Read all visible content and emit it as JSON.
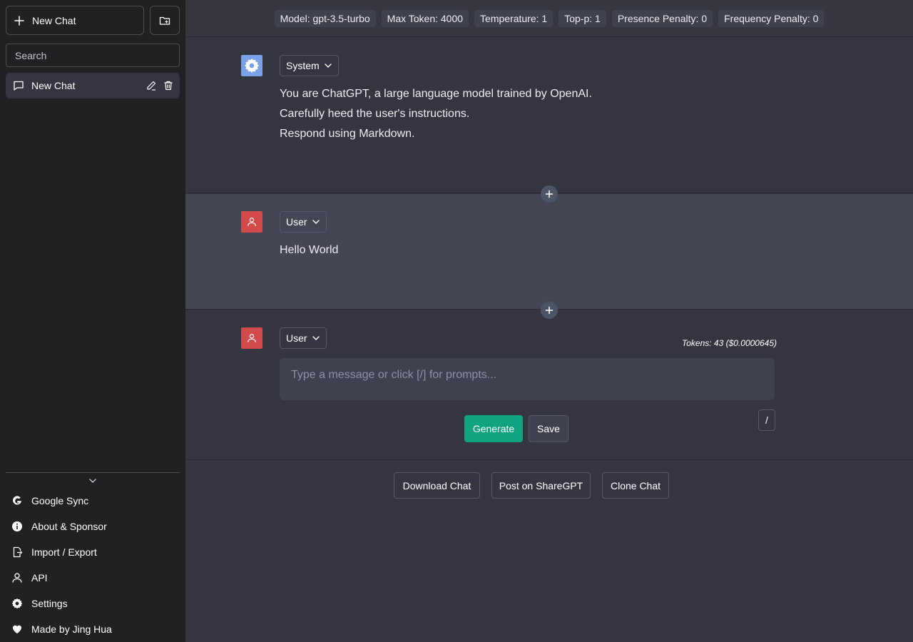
{
  "sidebar": {
    "new_chat_label": "New Chat",
    "new_folder_icon": "folder-plus-icon",
    "search_placeholder": "Search",
    "chats": [
      {
        "label": "New Chat",
        "icon": "chat-bubble-icon"
      }
    ],
    "menu": [
      {
        "label": "Google Sync",
        "icon": "google-icon"
      },
      {
        "label": "About & Sponsor",
        "icon": "info-icon"
      },
      {
        "label": "Import / Export",
        "icon": "file-export-icon"
      },
      {
        "label": "API",
        "icon": "person-icon"
      },
      {
        "label": "Settings",
        "icon": "gear-icon"
      },
      {
        "label": "Made by Jing Hua",
        "icon": "heart-icon"
      }
    ]
  },
  "config": {
    "model": "Model: gpt-3.5-turbo",
    "max_token": "Max Token: 4000",
    "temperature": "Temperature: 1",
    "top_p": "Top-p: 1",
    "presence_penalty": "Presence Penalty: 0",
    "frequency_penalty": "Frequency Penalty: 0"
  },
  "messages": {
    "system": {
      "role": "System",
      "lines": [
        "You are ChatGPT, a large language model trained by OpenAI.",
        "Carefully heed the user's instructions.",
        "Respond using Markdown."
      ]
    },
    "user": {
      "role": "User",
      "text": "Hello World"
    },
    "composer": {
      "role": "User",
      "tokens": "Tokens: 43 ($0.0000645)",
      "placeholder": "Type a message or click [/] for prompts...",
      "generate_label": "Generate",
      "save_label": "Save",
      "prompt_label": "/"
    }
  },
  "footer": {
    "download_label": "Download Chat",
    "share_label": "Post on ShareGPT",
    "clone_label": "Clone Chat"
  },
  "colors": {
    "sidebar_bg": "#202123",
    "main_bg": "#343541",
    "user_msg_bg": "#444654",
    "accent_green": "#10a37f",
    "system_avatar": "#7aa2e8",
    "user_avatar": "#d24a4a"
  }
}
